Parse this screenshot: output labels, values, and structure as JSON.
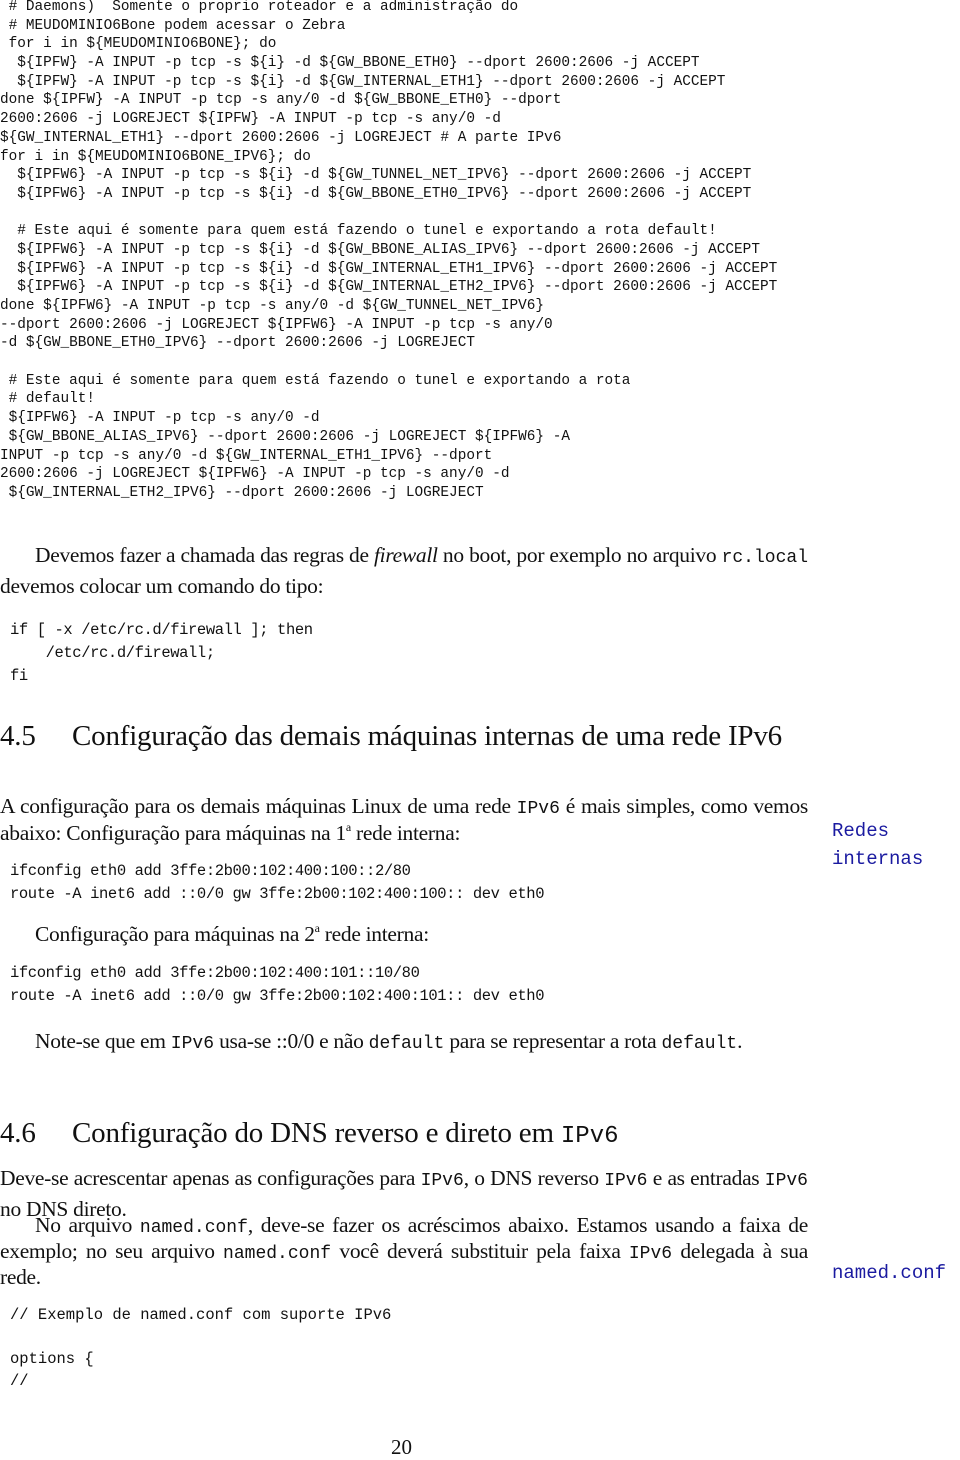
{
  "code_block_1": {
    "lines": [
      " # Daemons)  Somente o proprio roteador e a administração do",
      " # MEUDOMINIO6Bone podem acessar o Zebra",
      " for i in ${MEUDOMINIO6BONE}; do",
      "  ${IPFW} -A INPUT -p tcp -s ${i} -d ${GW_BBONE_ETH0} --dport 2600:2606 -j ACCEPT",
      "  ${IPFW} -A INPUT -p tcp -s ${i} -d ${GW_INTERNAL_ETH1} --dport 2600:2606 -j ACCEPT",
      "done ${IPFW} -A INPUT -p tcp -s any/0 -d ${GW_BBONE_ETH0} --dport",
      "2600:2606 -j LOGREJECT ${IPFW} -A INPUT -p tcp -s any/0 -d",
      "${GW_INTERNAL_ETH1} --dport 2600:2606 -j LOGREJECT # A parte IPv6",
      "for i in ${MEUDOMINIO6BONE_IPV6}; do",
      "  ${IPFW6} -A INPUT -p tcp -s ${i} -d ${GW_TUNNEL_NET_IPV6} --dport 2600:2606 -j ACCEPT",
      "  ${IPFW6} -A INPUT -p tcp -s ${i} -d ${GW_BBONE_ETH0_IPV6} --dport 2600:2606 -j ACCEPT",
      "",
      "  # Este aqui é somente para quem está fazendo o tunel e exportando a rota default!",
      "  ${IPFW6} -A INPUT -p tcp -s ${i} -d ${GW_BBONE_ALIAS_IPV6} --dport 2600:2606 -j ACCEPT",
      "  ${IPFW6} -A INPUT -p tcp -s ${i} -d ${GW_INTERNAL_ETH1_IPV6} --dport 2600:2606 -j ACCEPT",
      "  ${IPFW6} -A INPUT -p tcp -s ${i} -d ${GW_INTERNAL_ETH2_IPV6} --dport 2600:2606 -j ACCEPT",
      "done ${IPFW6} -A INPUT -p tcp -s any/0 -d ${GW_TUNNEL_NET_IPV6}",
      "--dport 2600:2606 -j LOGREJECT ${IPFW6} -A INPUT -p tcp -s any/0",
      "-d ${GW_BBONE_ETH0_IPV6} --dport 2600:2606 -j LOGREJECT",
      "",
      " # Este aqui é somente para quem está fazendo o tunel e exportando a rota",
      " # default!",
      " ${IPFW6} -A INPUT -p tcp -s any/0 -d",
      " ${GW_BBONE_ALIAS_IPV6} --dport 2600:2606 -j LOGREJECT ${IPFW6} -A",
      "INPUT -p tcp -s any/0 -d ${GW_INTERNAL_ETH1_IPV6} --dport",
      "2600:2606 -j LOGREJECT ${IPFW6} -A INPUT -p tcp -s any/0 -d",
      " ${GW_INTERNAL_ETH2_IPV6} --dport 2600:2606 -j LOGREJECT"
    ]
  },
  "para_firewall_boot": {
    "part1": "Devemos fazer a chamada das regras de ",
    "italic": "firewall",
    "part2": " no boot, por exemplo no arquivo ",
    "code": "rc.local",
    "part3": " devemos colocar um comando do tipo:"
  },
  "code_block_2": {
    "lines": [
      "if [ -x /etc/rc.d/firewall ]; then",
      "    /etc/rc.d/firewall;",
      "fi"
    ]
  },
  "section_4_5": {
    "number": "4.5",
    "title": "Configuração das demais máquinas internas de uma rede IPv6"
  },
  "para_4_5": {
    "part1": "A configuração para os demais máquinas Linux de uma rede ",
    "code": "IPv6",
    "part2": " é mais simples, como vemos abaixo: Configuração para máquinas na 1",
    "sup": "a",
    "part3": " rede interna:"
  },
  "margin_note_redes": "Redes\ninternas",
  "code_block_3": {
    "lines": [
      "ifconfig eth0 add 3ffe:2b00:102:400:100::2/80",
      "route -A inet6 add ::0/0 gw 3ffe:2b00:102:400:100:: dev eth0"
    ]
  },
  "para_second_net": {
    "part1": "Configuração para máquinas na 2",
    "sup": "a",
    "part2": " rede interna:"
  },
  "code_block_4": {
    "lines": [
      "ifconfig eth0 add 3ffe:2b00:102:400:101::10/80",
      "route -A inet6 add ::0/0 gw 3ffe:2b00:102:400:101:: dev eth0"
    ]
  },
  "para_note": {
    "part1": "Note-se que em ",
    "code1": "IPv6",
    "part2": " usa-se ::0/0 e não ",
    "code2": "default",
    "part3": " para se representar a rota ",
    "code3": "default",
    "part4": "."
  },
  "section_4_6": {
    "number": "4.6",
    "title_text": "Configuração do DNS reverso e direto em ",
    "title_code": "IPv6"
  },
  "para_4_6_a": {
    "part1": "Deve-se acrescentar apenas as configurações para ",
    "code1": "IPv6",
    "part2": ", o DNS reverso ",
    "code2": "IPv6",
    "part3": " e as entradas ",
    "code3": "IPv6",
    "part4": " no DNS direto."
  },
  "para_4_6_b": {
    "part1": "No arquivo ",
    "code1": "named.conf",
    "part2": ", deve-se fazer os acréscimos abaixo. Estamos usando a faixa de exemplo; no seu arquivo ",
    "code2": "named.conf",
    "part3": " você deverá substituir pela faixa ",
    "code3": "IPv6",
    "part4": " delegada à sua rede."
  },
  "margin_note_named": "named.conf",
  "code_block_5": {
    "lines": [
      "// Exemplo de named.conf com suporte IPv6",
      "",
      "options {",
      "//"
    ]
  },
  "page_number": "20"
}
